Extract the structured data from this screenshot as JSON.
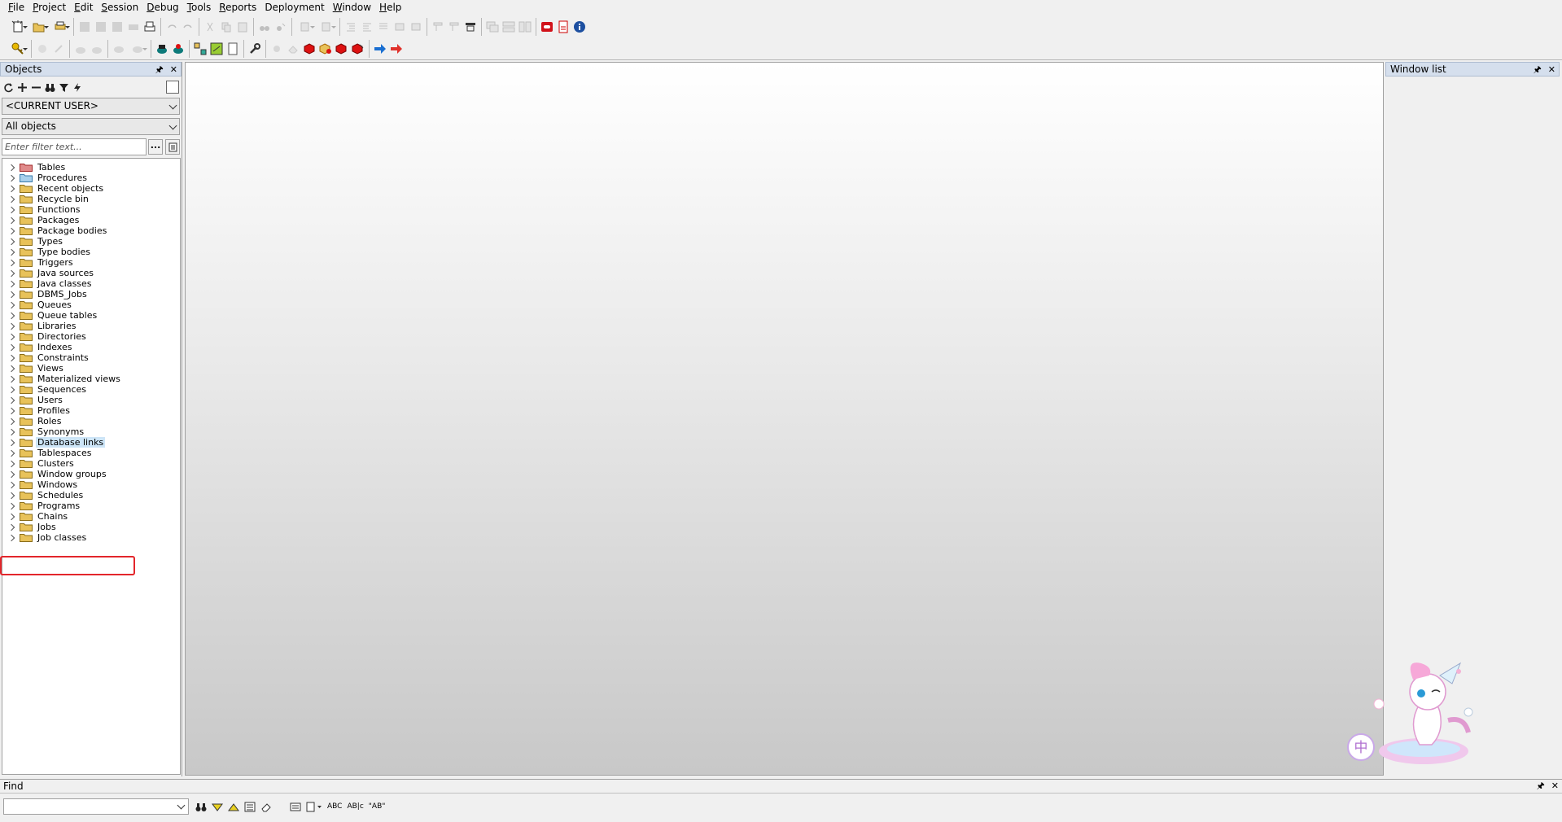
{
  "menubar": {
    "items": [
      {
        "label": "File",
        "u": "F",
        "rest": "ile"
      },
      {
        "label": "Project",
        "u": "P",
        "rest": "roject"
      },
      {
        "label": "Edit",
        "u": "E",
        "rest": "dit"
      },
      {
        "label": "Session",
        "u": "S",
        "rest": "ession"
      },
      {
        "label": "Debug",
        "u": "D",
        "rest": "ebug"
      },
      {
        "label": "Tools",
        "u": "T",
        "rest": "ools"
      },
      {
        "label": "Reports",
        "u": "R",
        "rest": "eports"
      },
      {
        "label": "Deployment",
        "u": "",
        "rest": "Deployment"
      },
      {
        "label": "Window",
        "u": "W",
        "rest": "indow"
      },
      {
        "label": "Help",
        "u": "H",
        "rest": "elp"
      }
    ]
  },
  "objects_panel": {
    "title": "Objects",
    "user_combo": "<CURRENT USER>",
    "objects_combo": "All objects",
    "filter_placeholder": "Enter filter text...",
    "filter_button": "...",
    "tree": [
      {
        "label": "Tables",
        "icon": "folder-red-icon"
      },
      {
        "label": "Procedures",
        "icon": "folder-blue-icon"
      },
      {
        "label": "Recent objects",
        "icon": "folder-icon"
      },
      {
        "label": "Recycle bin",
        "icon": "folder-icon"
      },
      {
        "label": "Functions",
        "icon": "folder-icon"
      },
      {
        "label": "Packages",
        "icon": "folder-icon"
      },
      {
        "label": "Package bodies",
        "icon": "folder-icon"
      },
      {
        "label": "Types",
        "icon": "folder-icon"
      },
      {
        "label": "Type bodies",
        "icon": "folder-icon"
      },
      {
        "label": "Triggers",
        "icon": "folder-icon"
      },
      {
        "label": "Java sources",
        "icon": "folder-icon"
      },
      {
        "label": "Java classes",
        "icon": "folder-icon"
      },
      {
        "label": "DBMS_Jobs",
        "icon": "folder-icon"
      },
      {
        "label": "Queues",
        "icon": "folder-icon"
      },
      {
        "label": "Queue tables",
        "icon": "folder-icon"
      },
      {
        "label": "Libraries",
        "icon": "folder-icon"
      },
      {
        "label": "Directories",
        "icon": "folder-icon"
      },
      {
        "label": "Indexes",
        "icon": "folder-icon"
      },
      {
        "label": "Constraints",
        "icon": "folder-icon"
      },
      {
        "label": "Views",
        "icon": "folder-icon"
      },
      {
        "label": "Materialized views",
        "icon": "folder-icon"
      },
      {
        "label": "Sequences",
        "icon": "folder-icon"
      },
      {
        "label": "Users",
        "icon": "folder-icon"
      },
      {
        "label": "Profiles",
        "icon": "folder-icon"
      },
      {
        "label": "Roles",
        "icon": "folder-icon"
      },
      {
        "label": "Synonyms",
        "icon": "folder-icon"
      },
      {
        "label": "Database links",
        "icon": "folder-icon",
        "selected": true
      },
      {
        "label": "Tablespaces",
        "icon": "folder-icon"
      },
      {
        "label": "Clusters",
        "icon": "folder-icon"
      },
      {
        "label": "Window groups",
        "icon": "folder-icon"
      },
      {
        "label": "Windows",
        "icon": "folder-icon"
      },
      {
        "label": "Schedules",
        "icon": "folder-icon"
      },
      {
        "label": "Programs",
        "icon": "folder-icon"
      },
      {
        "label": "Chains",
        "icon": "folder-icon"
      },
      {
        "label": "Jobs",
        "icon": "folder-icon"
      },
      {
        "label": "Job classes",
        "icon": "folder-icon"
      }
    ]
  },
  "window_list": {
    "title": "Window list"
  },
  "find_panel": {
    "title": "Find",
    "tools": [
      "binoculars-icon",
      "find-next-icon",
      "find-prev-icon",
      "highlight-icon",
      "clear-icon",
      "replace-icon",
      "doc-options-icon",
      "case-sensitive-icon",
      "whole-word-icon",
      "regex-icon"
    ],
    "case_label": "ABC",
    "word_label": "AB|c",
    "regex_label": "\"AB\""
  },
  "colors": {
    "panel_title_bg": "#d5dfed",
    "selection_bg": "#cde5f7",
    "highlight_border": "#e3262b",
    "folder_yellow": "#e8c25a"
  }
}
